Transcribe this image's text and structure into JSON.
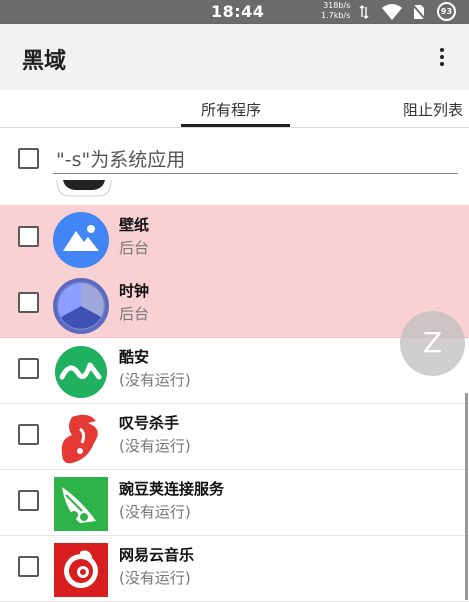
{
  "status_bar": {
    "time": "18:44",
    "upload_speed": "318b/s",
    "download_speed": "1.7kb/s",
    "battery": "93",
    "icons": [
      "data-arrows-icon",
      "wifi-icon",
      "no-sim-icon",
      "battery-icon"
    ]
  },
  "app_bar": {
    "title": "黑域",
    "overflow_icon": "more-vert-icon"
  },
  "tabs": [
    {
      "label": "所有程序",
      "selected": true
    },
    {
      "label": "阻止列表",
      "selected": false
    }
  ],
  "filter": {
    "placeholder": "\"-s\"为系统应用",
    "checked": false
  },
  "apps": [
    {
      "name": "壁纸",
      "status": "后台",
      "highlighted": true,
      "checked": false,
      "icon": "wallpaper-icon"
    },
    {
      "name": "时钟",
      "status": "后台",
      "highlighted": true,
      "checked": false,
      "icon": "clock-icon"
    },
    {
      "name": "酷安",
      "status": "(没有运行)",
      "highlighted": false,
      "checked": false,
      "icon": "coolapk-icon"
    },
    {
      "name": "叹号杀手",
      "status": "(没有运行)",
      "highlighted": false,
      "checked": false,
      "icon": "exclamation-killer-icon"
    },
    {
      "name": "豌豆荚连接服务",
      "status": "(没有运行)",
      "highlighted": false,
      "checked": false,
      "icon": "wandoujia-icon"
    },
    {
      "name": "网易云音乐",
      "status": "(没有运行)",
      "highlighted": false,
      "checked": false,
      "icon": "netease-music-icon"
    }
  ],
  "fab": {
    "label": "Z",
    "icon": "z-icon"
  },
  "colors": {
    "highlight": "#fad1d3",
    "app_bar": "#f2f2f2",
    "status_bar": "#6b6b6b"
  }
}
